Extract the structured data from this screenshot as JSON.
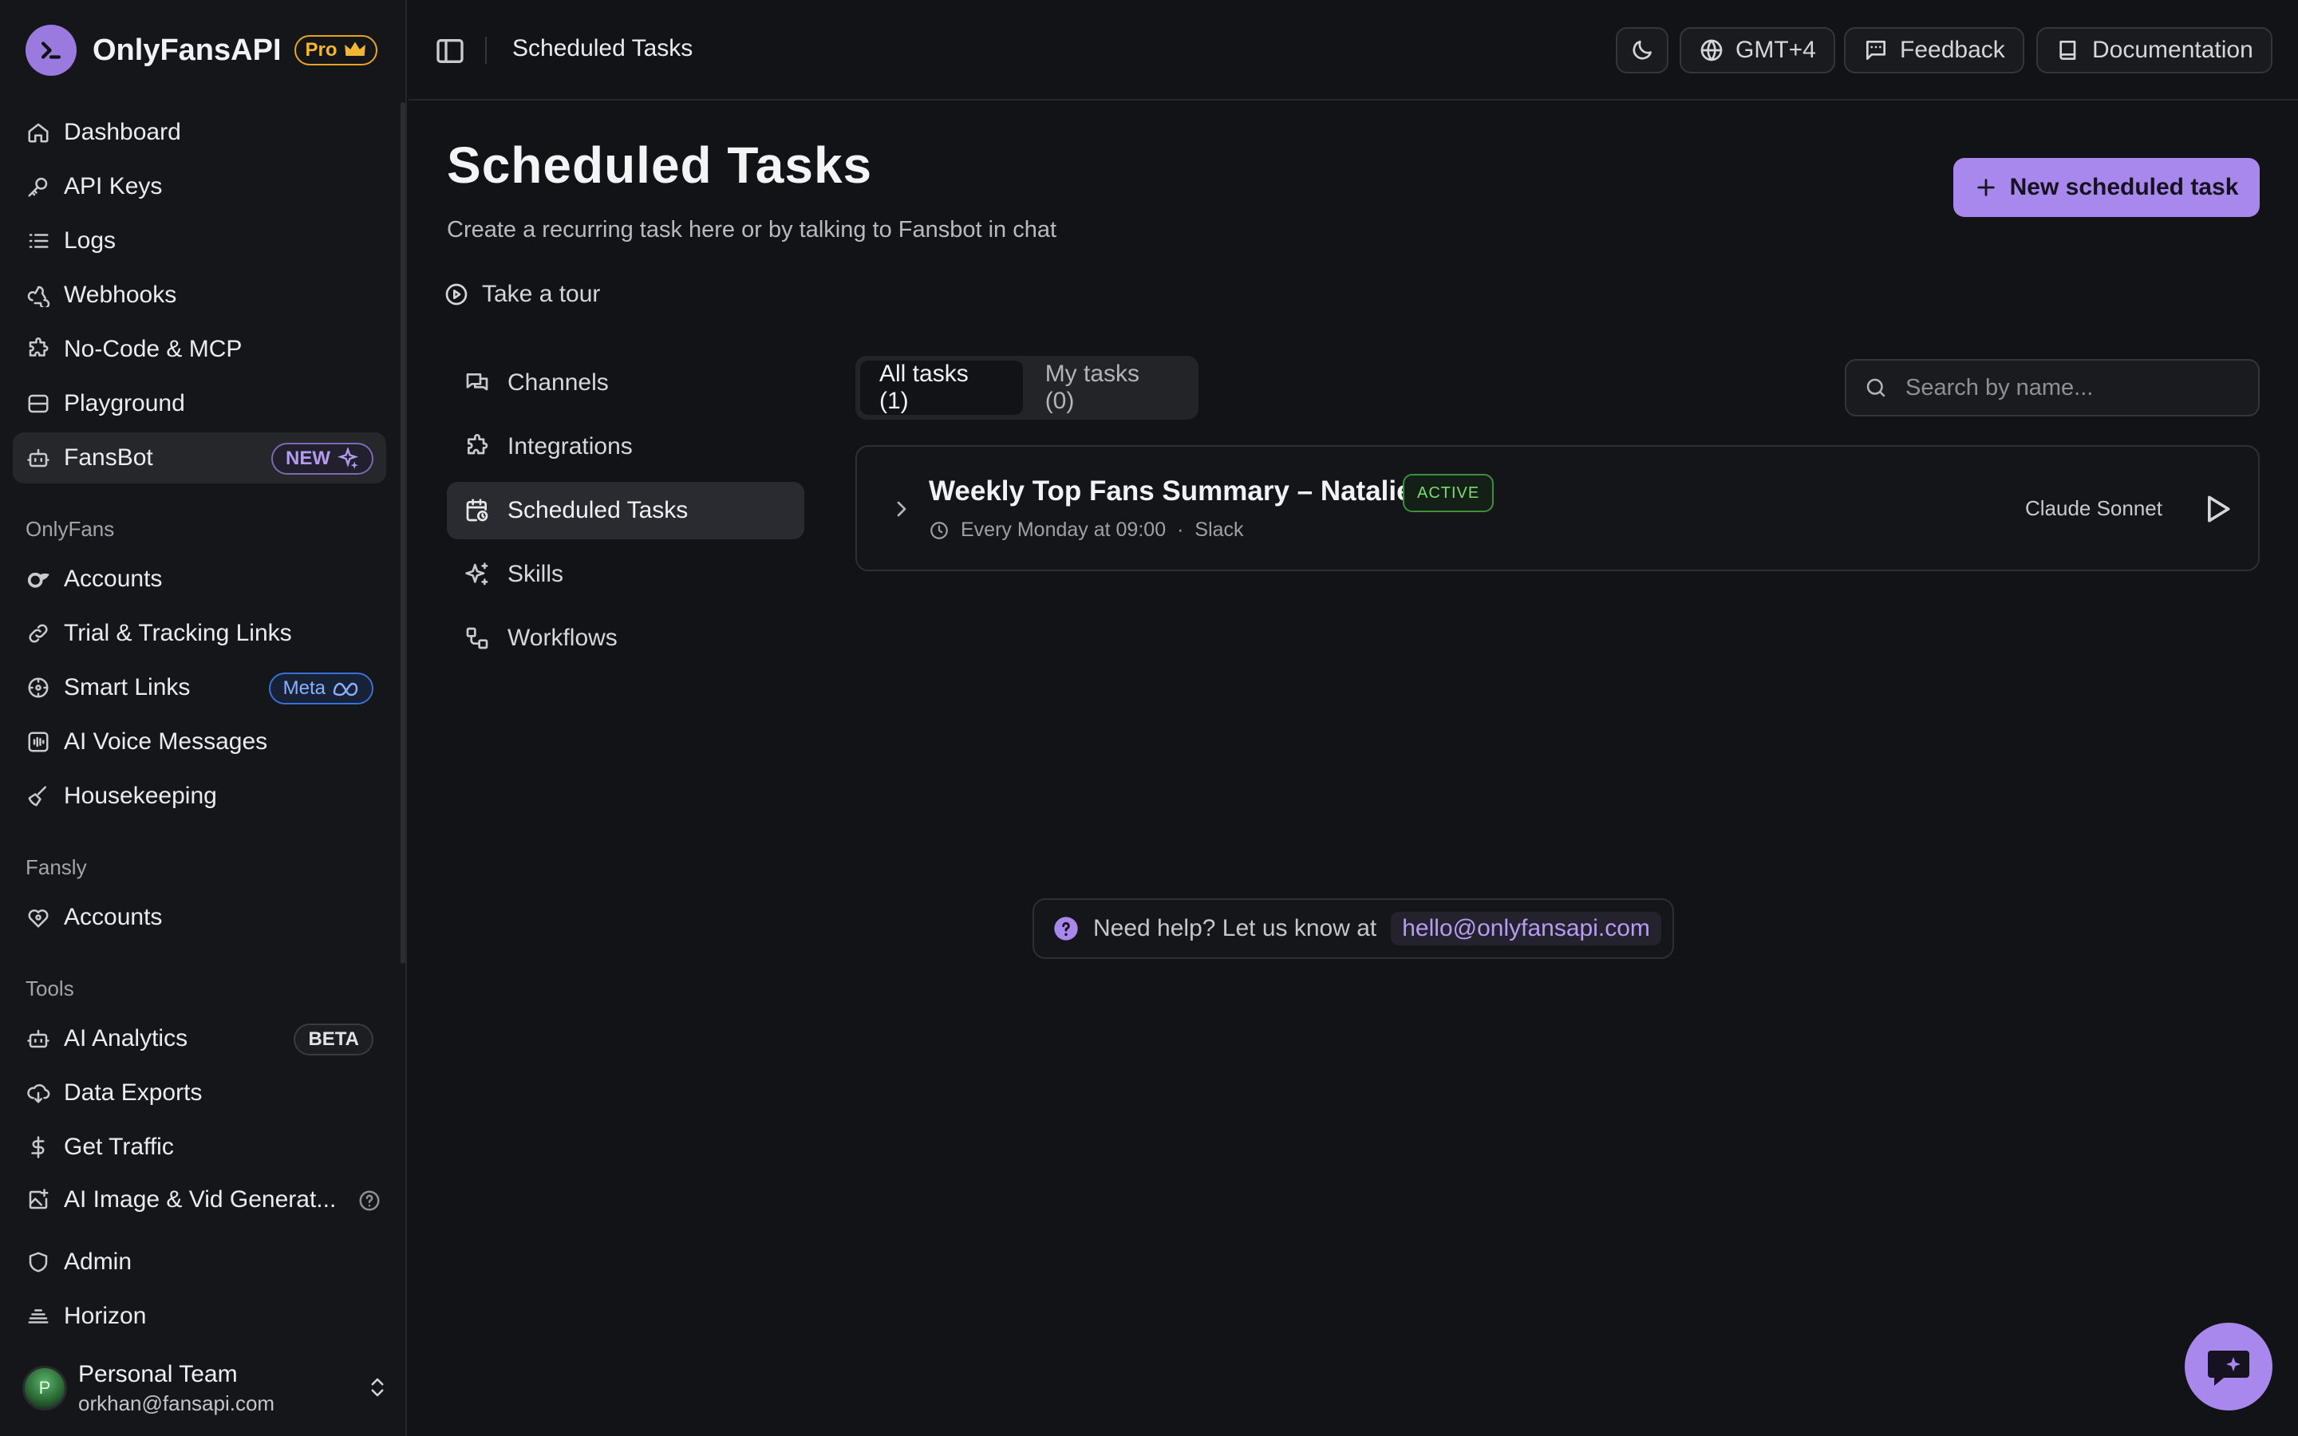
{
  "brand": {
    "name": "OnlyFansAPI",
    "plan_badge": "Pro"
  },
  "sidebar": {
    "main_items": [
      {
        "label": "Dashboard",
        "icon": "home-icon"
      },
      {
        "label": "API Keys",
        "icon": "key-icon"
      },
      {
        "label": "Logs",
        "icon": "list-icon"
      },
      {
        "label": "Webhooks",
        "icon": "webhook-icon"
      },
      {
        "label": "No-Code & MCP",
        "icon": "puzzle-icon"
      },
      {
        "label": "Playground",
        "icon": "gamepad-icon"
      },
      {
        "label": "FansBot",
        "icon": "bot-icon",
        "badge": "NEW",
        "active": true
      }
    ],
    "onlyfans_section": "OnlyFans",
    "onlyfans_items": [
      {
        "label": "Accounts",
        "icon": "onlyfans-logo-icon"
      },
      {
        "label": "Trial & Tracking Links",
        "icon": "link-icon"
      },
      {
        "label": "Smart Links",
        "icon": "smart-link-icon",
        "badge": "Meta"
      },
      {
        "label": "AI Voice Messages",
        "icon": "audio-wave-icon"
      },
      {
        "label": "Housekeeping",
        "icon": "broom-icon"
      }
    ],
    "fansly_section": "Fansly",
    "fansly_items": [
      {
        "label": "Accounts",
        "icon": "fansly-logo-icon"
      }
    ],
    "tools_section": "Tools",
    "tools_items": [
      {
        "label": "AI Analytics",
        "icon": "bot-icon",
        "badge": "BETA"
      },
      {
        "label": "Data Exports",
        "icon": "cloud-download-icon"
      },
      {
        "label": "Get Traffic",
        "icon": "dollar-icon"
      },
      {
        "label": "AI Image & Vid Generat...",
        "icon": "image-sparkle-icon"
      }
    ],
    "bottom_items": [
      {
        "label": "Admin",
        "icon": "shield-icon"
      },
      {
        "label": "Horizon",
        "icon": "horizon-icon"
      }
    ],
    "user": {
      "initial": "P",
      "name": "Personal Team",
      "email": "orkhan@fansapi.com"
    }
  },
  "topbar": {
    "title": "Scheduled Tasks",
    "timezone": "GMT+4",
    "feedback": "Feedback",
    "documentation": "Documentation"
  },
  "page": {
    "title": "Scheduled Tasks",
    "subtitle": "Create a recurring task here or by talking to Fansbot in chat",
    "tour": "Take a tour",
    "new_task_button": "New scheduled task"
  },
  "subnav": [
    {
      "label": "Channels",
      "icon": "chat-bubbles-icon"
    },
    {
      "label": "Integrations",
      "icon": "puzzle-icon"
    },
    {
      "label": "Scheduled Tasks",
      "icon": "calendar-clock-icon",
      "active": true
    },
    {
      "label": "Skills",
      "icon": "sparkles-icon"
    },
    {
      "label": "Workflows",
      "icon": "workflow-icon"
    }
  ],
  "tabs": [
    {
      "label": "All tasks (1)",
      "active": true
    },
    {
      "label": "My tasks (0)",
      "active": false
    }
  ],
  "search": {
    "placeholder": "Search by name..."
  },
  "tasks": [
    {
      "name": "Weekly Top Fans Summary – Natalie",
      "status": "ACTIVE",
      "schedule": "Every Monday at 09:00",
      "separator": "·",
      "channel": "Slack",
      "model": "Claude Sonnet"
    }
  ],
  "help": {
    "text": "Need help? Let us know at",
    "email": "hello@onlyfansapi.com"
  },
  "colors": {
    "accent": "#a888ec",
    "background": "#121316",
    "active_status": "#7ddc6e",
    "pro": "#f3b633"
  }
}
